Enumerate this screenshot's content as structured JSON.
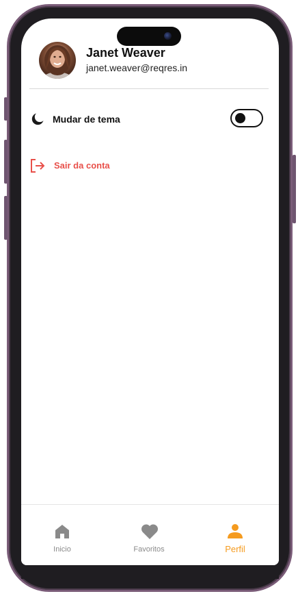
{
  "profile": {
    "name": "Janet Weaver",
    "email": "janet.weaver@reqres.in"
  },
  "settings": {
    "theme_label": "Mudar de tema",
    "theme_toggle_on": false,
    "logout_label": "Sair da conta"
  },
  "bottom_nav": {
    "items": [
      {
        "label": "Inicio",
        "icon": "home-icon",
        "active": false
      },
      {
        "label": "Favoritos",
        "icon": "heart-icon",
        "active": false
      },
      {
        "label": "Perfil",
        "icon": "person-icon",
        "active": true
      }
    ]
  },
  "colors": {
    "accent": "#f59b1f",
    "danger": "#e8504a",
    "inactive": "#8a8a8a",
    "text": "#111111"
  }
}
